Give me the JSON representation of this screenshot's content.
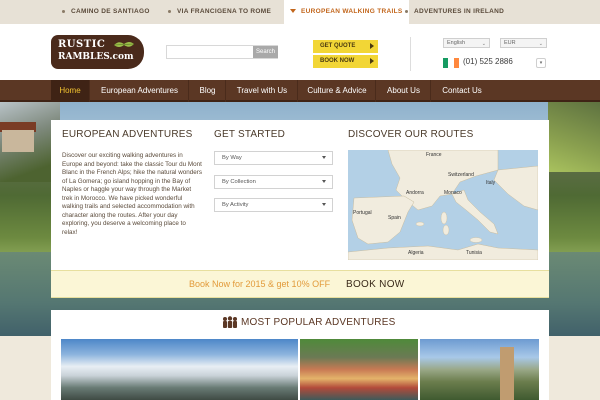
{
  "topbar": {
    "tabs": [
      {
        "label": "CAMINO DE SANTIAGO"
      },
      {
        "label": "VIA FRANCIGENA TO ROME"
      },
      {
        "label": "EUROPEAN WALKING TRAILS"
      },
      {
        "label": "ADVENTURES IN IRELAND"
      }
    ]
  },
  "header": {
    "logo": {
      "line1": "RUSTIC",
      "line2": "RAMBLES.com"
    },
    "search": {
      "placeholder": "",
      "button_label": "Search"
    },
    "get_quote_label": "GET QUOTE",
    "book_now_label": "BOOK NOW",
    "language": "English",
    "currency": "EUR",
    "phone": "(01) 525 2886",
    "flag_colors": [
      "#169b62",
      "#ffffff",
      "#ff883e"
    ]
  },
  "nav": {
    "items": [
      {
        "label": "Home"
      },
      {
        "label": "European Adventures"
      },
      {
        "label": "Blog"
      },
      {
        "label": "Travel with Us"
      },
      {
        "label": "Culture & Advice"
      },
      {
        "label": "About Us"
      },
      {
        "label": "Contact Us"
      }
    ]
  },
  "panel": {
    "intro_title": "EUROPEAN ADVENTURES",
    "intro_text": "Discover our exciting walking adventures in Europe and beyond: take the classic Tour du Mont Blanc in the French Alps; hike the natural wonders of La Gomera; go island hopping in the Bay of Naples or haggle your way through the Market trek in Morocco. We have picked wonderful walking trails and selected accommodation with character along the routes. After your day exploring, you deserve a welcoming place to relax!",
    "get_started_title": "GET STARTED",
    "dropdowns": [
      {
        "label": "By Way"
      },
      {
        "label": "By Collection"
      },
      {
        "label": "By Activity"
      }
    ],
    "routes_title": "DISCOVER OUR ROUTES",
    "map_labels": [
      "France",
      "Italy",
      "Spain",
      "Portugal",
      "Monaco",
      "Andorra",
      "Algeria",
      "Tunisia",
      "Switzerland"
    ]
  },
  "promo": {
    "text": "Book Now for 2015 & get 10% OFF",
    "book_label": "BOOK NOW"
  },
  "popular": {
    "title": "MOST POPULAR ADVENTURES"
  },
  "colors": {
    "nav_bg": "#5b3724",
    "accent_orange": "#c2661c",
    "button_yellow": "#f2d636",
    "promo_text": "#e29a3a"
  }
}
